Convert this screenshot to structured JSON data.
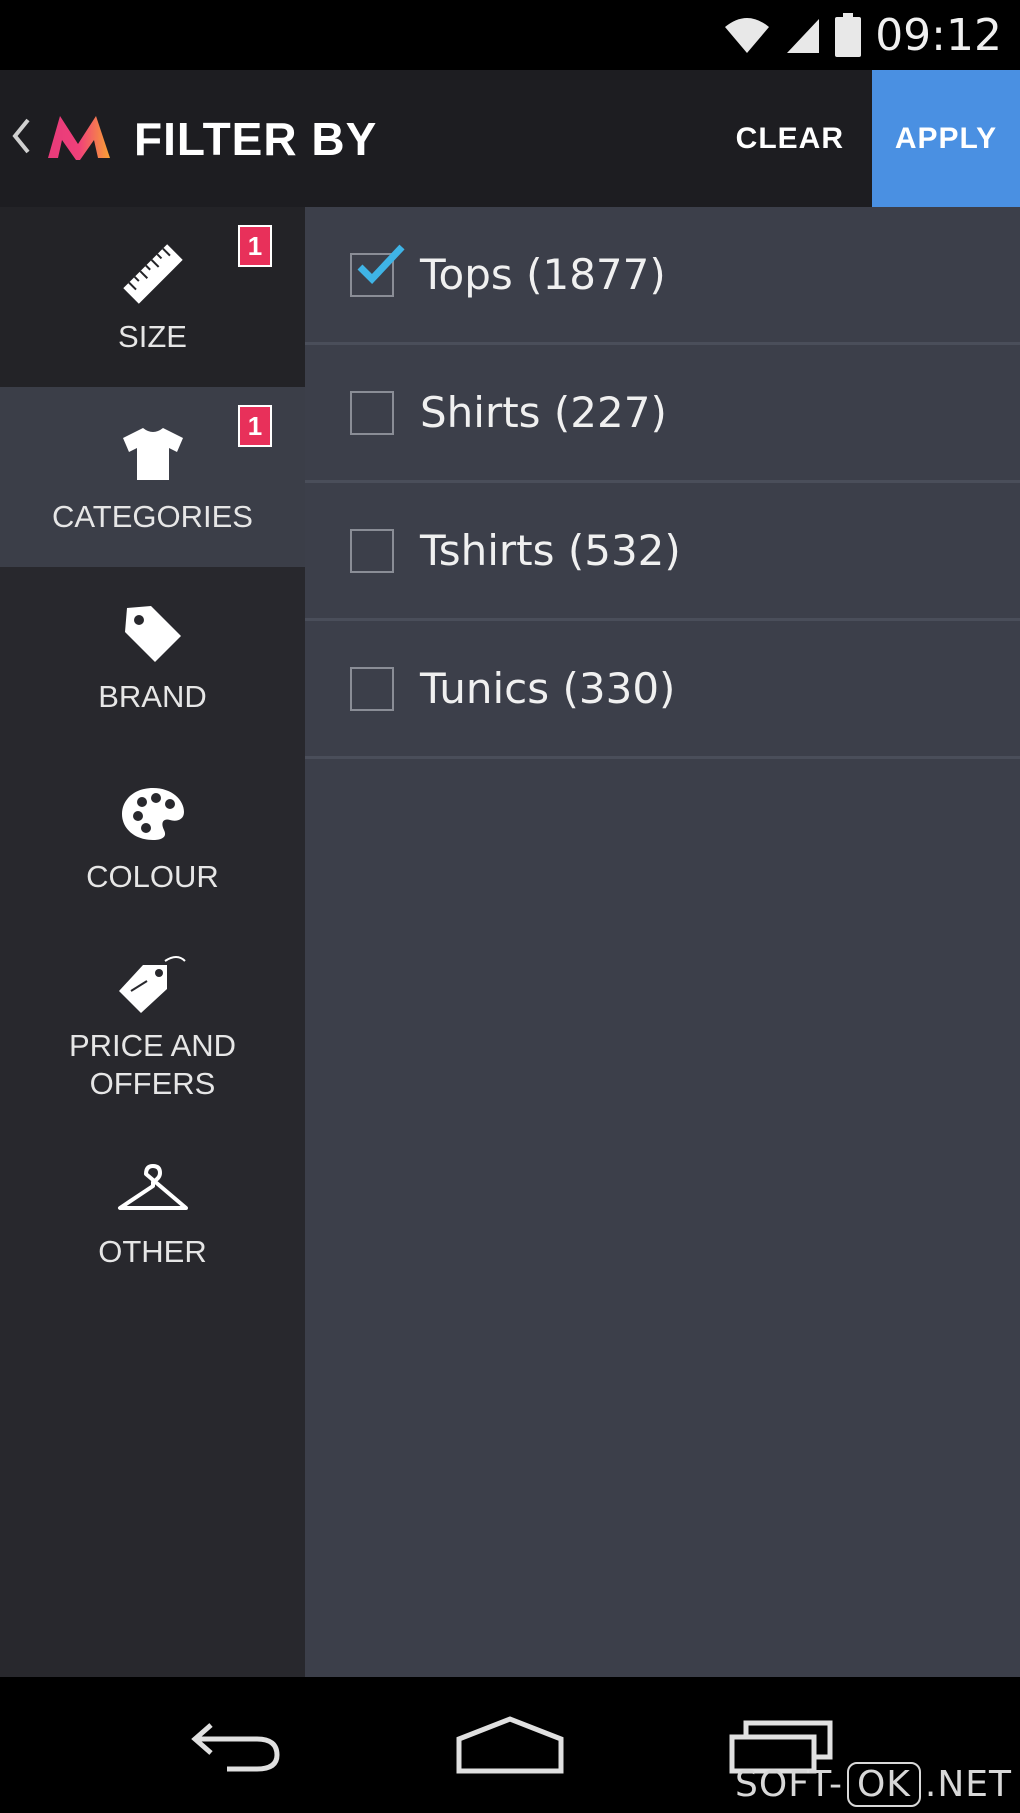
{
  "status_bar": {
    "time": "09:12"
  },
  "app_bar": {
    "title": "FILTER BY",
    "clear_label": "CLEAR",
    "apply_label": "APPLY",
    "accent_color": "#4a90e2",
    "logo_icon": "myntra-logo"
  },
  "sidebar": {
    "items": [
      {
        "label": "SIZE",
        "icon": "ruler-icon",
        "badge": "1"
      },
      {
        "label": "CATEGORIES",
        "icon": "tshirt-icon",
        "badge": "1",
        "active": true
      },
      {
        "label": "BRAND",
        "icon": "tag-icon"
      },
      {
        "label": "COLOUR",
        "icon": "palette-icon"
      },
      {
        "label": "PRICE AND OFFERS",
        "icon": "price-tag-icon"
      },
      {
        "label": "OTHER",
        "icon": "hanger-icon"
      }
    ]
  },
  "options": [
    {
      "label": "Tops (1877)",
      "checked": true
    },
    {
      "label": "Shirts (227)",
      "checked": false
    },
    {
      "label": "Tshirts (532)",
      "checked": false
    },
    {
      "label": "Tunics (330)",
      "checked": false
    }
  ],
  "watermark": {
    "pre": "SOFT-",
    "boxed": "OK",
    "post": ".NET"
  }
}
